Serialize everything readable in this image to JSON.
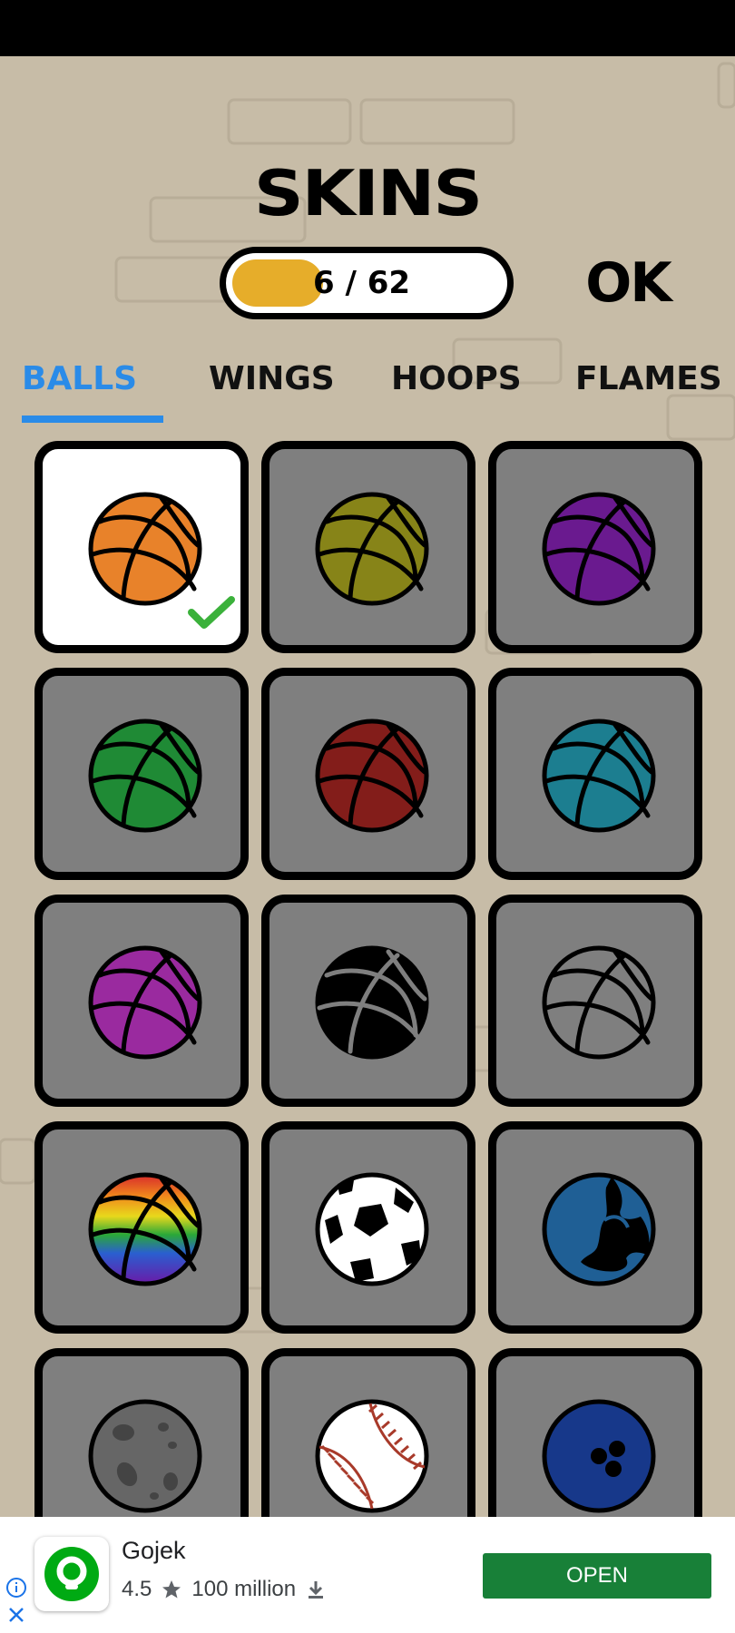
{
  "screen": {
    "title": "SKINS",
    "progress": {
      "text": "6 / 62",
      "unlocked": 6,
      "total": 62
    },
    "ok_label": "OK"
  },
  "tabs": [
    {
      "label": "BALLS",
      "active": true
    },
    {
      "label": "WINGS",
      "active": false
    },
    {
      "label": "HOOPS",
      "active": false
    },
    {
      "label": "FLAMES",
      "active": false
    }
  ],
  "skins": [
    {
      "name": "orange-basketball",
      "color": "#e8822a",
      "selected": true
    },
    {
      "name": "olive-basketball",
      "color": "#878418"
    },
    {
      "name": "purple-basketball",
      "color": "#6a1a8f"
    },
    {
      "name": "green-basketball",
      "color": "#1f8a35"
    },
    {
      "name": "red-basketball",
      "color": "#831d1a"
    },
    {
      "name": "teal-basketball",
      "color": "#1c7e90"
    },
    {
      "name": "magenta-basketball",
      "color": "#9a2a9f"
    },
    {
      "name": "black-basketball",
      "color": "#000000"
    },
    {
      "name": "gray-basketball",
      "color": "#7f7f7f"
    },
    {
      "name": "rainbow-basketball",
      "color": "rainbow"
    },
    {
      "name": "soccer-ball",
      "color": "#ffffff"
    },
    {
      "name": "globe-ball",
      "color": "#1f5f95"
    },
    {
      "name": "moon-ball",
      "color": "#666666"
    },
    {
      "name": "baseball",
      "color": "#ffffff"
    },
    {
      "name": "bowling-ball",
      "color": "#17388a"
    }
  ],
  "ad": {
    "app_name": "Gojek",
    "rating": "4.5",
    "downloads": "100 million",
    "open_label": "OPEN",
    "brand_color": "#00aa13",
    "button_color": "#188038"
  }
}
